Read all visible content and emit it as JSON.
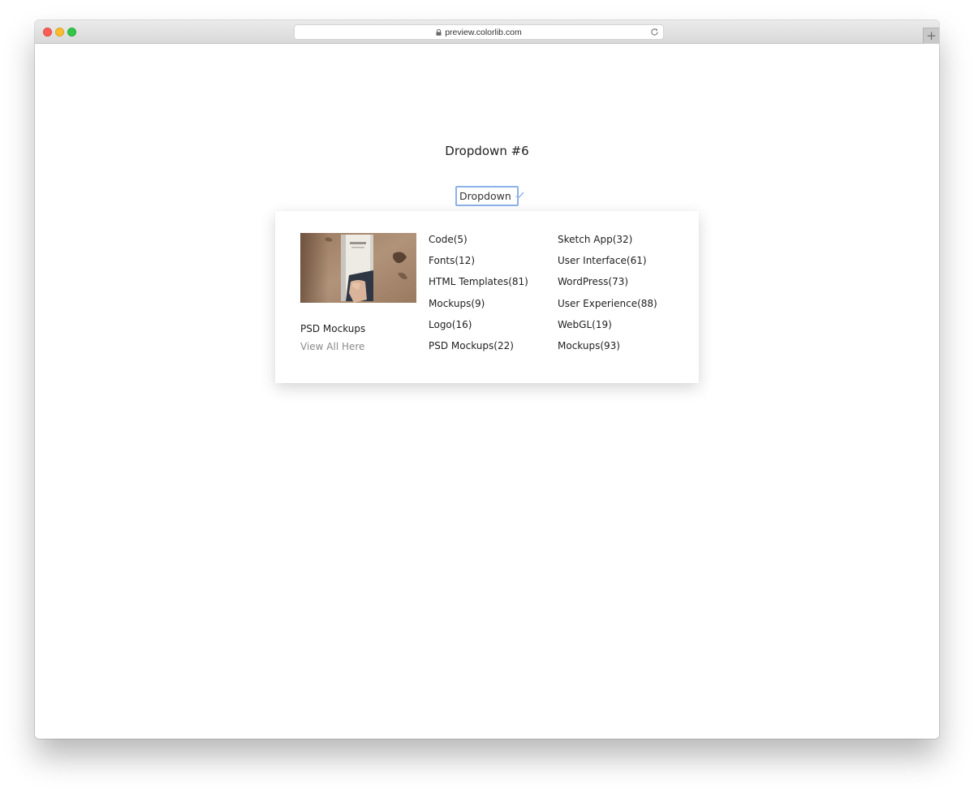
{
  "browser": {
    "url": "preview.colorlib.com",
    "new_tab_label": "+"
  },
  "page": {
    "heading": "Dropdown #6"
  },
  "dropdown": {
    "label": "Dropdown",
    "state": "open",
    "feature": {
      "title": "PSD Mockups",
      "link": "View All Here"
    },
    "columns": [
      [
        {
          "label": "Code(5)"
        },
        {
          "label": "Fonts(12)"
        },
        {
          "label": "HTML Templates(81)"
        },
        {
          "label": "Mockups(9)"
        },
        {
          "label": "Logo(16)"
        },
        {
          "label": "PSD Mockups(22)"
        }
      ],
      [
        {
          "label": "Sketch App(32)"
        },
        {
          "label": "User Interface(61)"
        },
        {
          "label": "WordPress(73)"
        },
        {
          "label": "User Experience(88)"
        },
        {
          "label": "WebGL(19)"
        },
        {
          "label": "Mockups(93)"
        }
      ]
    ]
  },
  "colors": {
    "focus_ring": "#8db2e8",
    "text": "#1e1e1e",
    "muted_link": "#8a8a8a"
  }
}
